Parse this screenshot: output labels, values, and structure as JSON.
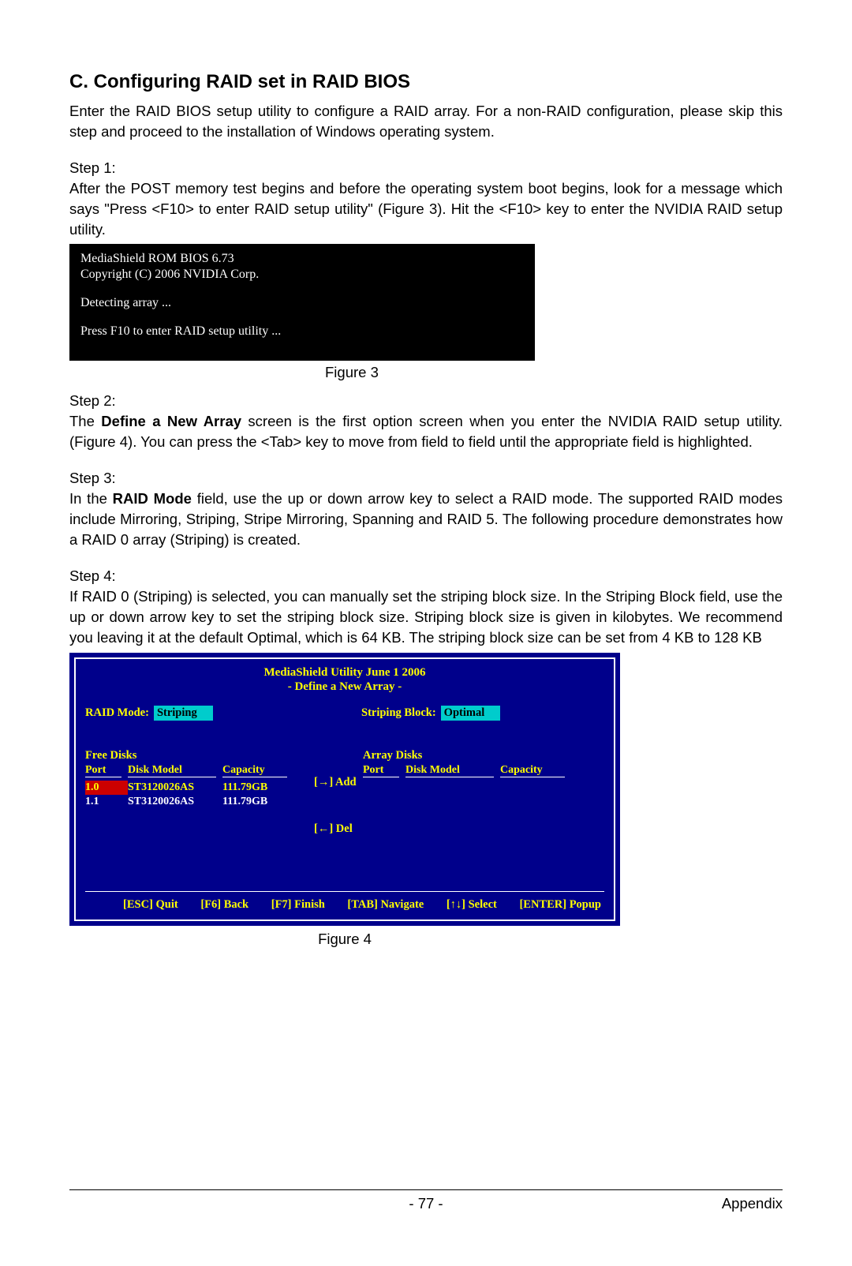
{
  "heading": "C. Configuring RAID set in RAID BIOS",
  "intro": "Enter the RAID BIOS setup utility to configure a RAID array. For a non-RAID configuration, please skip this step and proceed to the installation of Windows operating system.",
  "step1_label": "Step 1:",
  "step1_text": "After the POST memory test begins and before the operating system boot begins, look for a message which says \"Press <F10> to enter RAID setup utility\" (Figure 3). Hit the <F10> key to enter the NVIDIA RAID setup utility.",
  "fig3": {
    "l1": "MediaShield ROM BIOS 6.73",
    "l2": "Copyright (C) 2006 NVIDIA Corp.",
    "l3": "Detecting array ...",
    "l4": "Press F10 to enter RAID setup utility ..."
  },
  "fig3_caption": "Figure 3",
  "step2_label": "Step 2:",
  "step2_pre": "The ",
  "step2_bold": "Define a New Array",
  "step2_post": " screen is the first option screen when you enter the NVIDIA RAID setup utility. (Figure 4). You can press the <Tab> key to move from field to field until the appropriate field is highlighted.",
  "step3_label": "Step 3:",
  "step3_pre": "In the ",
  "step3_bold": "RAID Mode",
  "step3_post": " field, use the up or down arrow key to select a RAID mode. The supported RAID modes include Mirroring, Striping, Stripe Mirroring, Spanning and RAID 5. The following procedure demonstrates how a RAID 0 array (Striping) is created.",
  "step4_label": "Step 4:",
  "step4_pre": "If RAID 0 (Striping) is selected, you can manually set the striping block size. In the ",
  "step4_bold1": "Striping Block",
  "step4_mid": " field, use the up or down arrow key to set the striping block size. Striping block size is given in kilobytes. We recommend you leaving it at the default ",
  "step4_bold2": "Optimal",
  "step4_post": ", which is 64 KB. The striping block size can be set from 4 KB to 128 KB",
  "fig4": {
    "title1": "MediaShield Utility June 1 2006",
    "title2": "- Define a New Array -",
    "raid_mode_label": "RAID Mode:",
    "raid_mode_value": "Striping",
    "striping_block_label": "Striping Block:",
    "striping_block_value": "Optimal",
    "free_disks_title": "Free Disks",
    "array_disks_title": "Array Disks",
    "col_port": "Port",
    "col_model": "Disk Model",
    "col_cap": "Capacity",
    "free_disks": [
      {
        "port": "1.0",
        "model": "ST3120026AS",
        "cap": "111.79GB",
        "selected": true
      },
      {
        "port": "1.1",
        "model": "ST3120026AS",
        "cap": "111.79GB",
        "selected": false
      }
    ],
    "array_disks": [],
    "add": "[→] Add",
    "del": "[←] Del",
    "footer": {
      "esc": "[ESC] Quit",
      "f6": "[F6] Back",
      "f7": "[F7] Finish",
      "tab": "[TAB] Navigate",
      "arrows": "[↑↓] Select",
      "enter": "[ENTER] Popup"
    }
  },
  "fig4_caption": "Figure 4",
  "footer": {
    "page": "- 77 -",
    "section": "Appendix"
  }
}
